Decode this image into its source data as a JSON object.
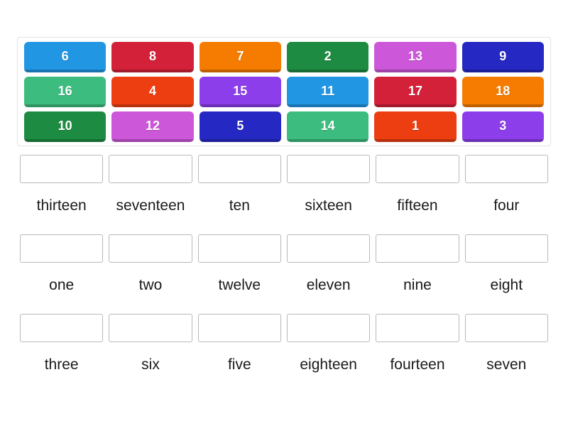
{
  "tile_bank": {
    "name": "number-tiles",
    "rows": [
      [
        {
          "label": "6",
          "color": "#2196E3"
        },
        {
          "label": "8",
          "color": "#D32139"
        },
        {
          "label": "7",
          "color": "#F57C00"
        },
        {
          "label": "2",
          "color": "#1E8B42"
        },
        {
          "label": "13",
          "color": "#CC57D9"
        },
        {
          "label": "9",
          "color": "#2628C4"
        }
      ],
      [
        {
          "label": "16",
          "color": "#3CBC7E"
        },
        {
          "label": "4",
          "color": "#EC3E10"
        },
        {
          "label": "15",
          "color": "#8B3EEA"
        },
        {
          "label": "11",
          "color": "#2196E3"
        },
        {
          "label": "17",
          "color": "#D32139"
        },
        {
          "label": "18",
          "color": "#F57C00"
        }
      ],
      [
        {
          "label": "10",
          "color": "#1E8B42"
        },
        {
          "label": "12",
          "color": "#CC57D9"
        },
        {
          "label": "5",
          "color": "#2628C4"
        },
        {
          "label": "14",
          "color": "#3CBC7E"
        },
        {
          "label": "1",
          "color": "#EC3E10"
        },
        {
          "label": "3",
          "color": "#8B3EEA"
        }
      ]
    ]
  },
  "answers": {
    "rows": [
      [
        {
          "word": "thirteen",
          "dropped": ""
        },
        {
          "word": "seventeen",
          "dropped": ""
        },
        {
          "word": "ten",
          "dropped": ""
        },
        {
          "word": "sixteen",
          "dropped": ""
        },
        {
          "word": "fifteen",
          "dropped": ""
        },
        {
          "word": "four",
          "dropped": ""
        }
      ],
      [
        {
          "word": "one",
          "dropped": ""
        },
        {
          "word": "two",
          "dropped": ""
        },
        {
          "word": "twelve",
          "dropped": ""
        },
        {
          "word": "eleven",
          "dropped": ""
        },
        {
          "word": "nine",
          "dropped": ""
        },
        {
          "word": "eight",
          "dropped": ""
        }
      ],
      [
        {
          "word": "three",
          "dropped": ""
        },
        {
          "word": "six",
          "dropped": ""
        },
        {
          "word": "five",
          "dropped": ""
        },
        {
          "word": "eighteen",
          "dropped": ""
        },
        {
          "word": "fourteen",
          "dropped": ""
        },
        {
          "word": "seven",
          "dropped": ""
        }
      ]
    ]
  },
  "colors": {
    "page_background": "#ffffff",
    "bank_border": "#e3e3e3",
    "dropzone_border": "#b9b9b9",
    "word_text": "#1a1a1a",
    "tile_text": "#ffffff"
  }
}
